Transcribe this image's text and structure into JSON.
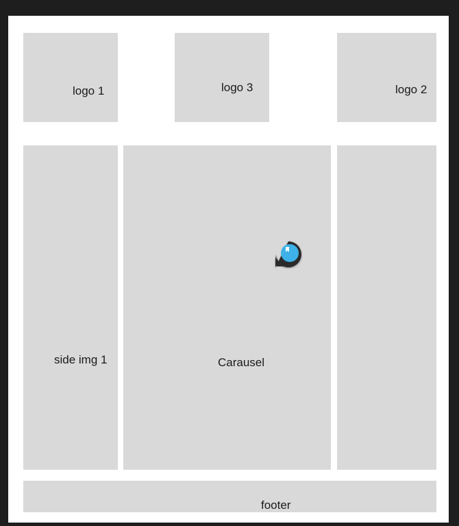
{
  "frame": {
    "name": "",
    "background": "#ffffff",
    "canvas_background": "#1e1e1e",
    "placeholder_color": "#d9d9d9"
  },
  "boxes": {
    "logo1": "logo 1",
    "logo3": "logo 3",
    "logo2": "logo 2",
    "side_img1": "side img 1",
    "carousel": "Carausel",
    "side_img2": "",
    "footer": "footer"
  },
  "comment_pin": {
    "icon": "comment-pin-icon",
    "color": "#3db1e8"
  }
}
